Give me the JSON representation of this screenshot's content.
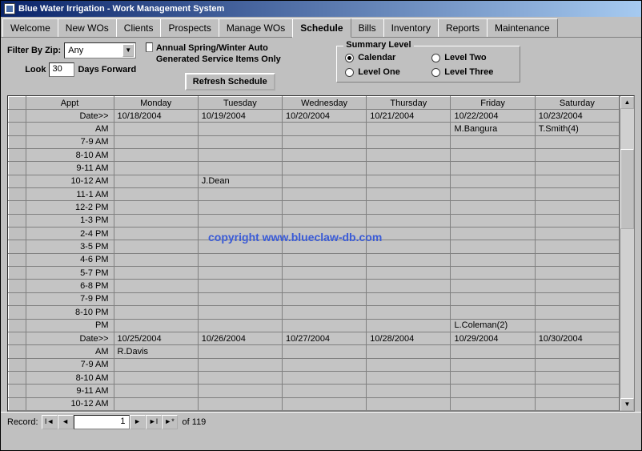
{
  "window": {
    "title": "Blue Water Irrigation - Work Management System"
  },
  "tabs": [
    "Welcome",
    "New WOs",
    "Clients",
    "Prospects",
    "Manage WOs",
    "Schedule",
    "Bills",
    "Inventory",
    "Reports",
    "Maintenance"
  ],
  "active_tab": "Schedule",
  "filter": {
    "zip_label": "Filter By Zip:",
    "zip_value": "Any",
    "look_label": "Look",
    "look_value": "30",
    "days_forward": "Days Forward"
  },
  "annual": {
    "label": "Annual Spring/Winter Auto Generated Service Items Only",
    "checked": false
  },
  "refresh_btn": "Refresh Schedule",
  "summary": {
    "legend": "Summary Level",
    "options": [
      "Calendar",
      "Level Two",
      "Level One",
      "Level Three"
    ],
    "selected": "Calendar"
  },
  "grid": {
    "headers": [
      "Appt",
      "Monday",
      "Tuesday",
      "Wednesday",
      "Thursday",
      "Friday",
      "Saturday"
    ],
    "rows": [
      {
        "appt": "Date>>",
        "cells": [
          "10/18/2004",
          "10/19/2004",
          "10/20/2004",
          "10/21/2004",
          "10/22/2004",
          "10/23/2004"
        ]
      },
      {
        "appt": "AM",
        "cells": [
          "",
          "",
          "",
          "",
          "M.Bangura",
          "T.Smith(4)"
        ]
      },
      {
        "appt": "7-9 AM",
        "cells": [
          "",
          "",
          "",
          "",
          "",
          ""
        ]
      },
      {
        "appt": "8-10 AM",
        "cells": [
          "",
          "",
          "",
          "",
          "",
          ""
        ]
      },
      {
        "appt": "9-11 AM",
        "cells": [
          "",
          "",
          "",
          "",
          "",
          ""
        ]
      },
      {
        "appt": "10-12 AM",
        "cells": [
          "",
          "J.Dean",
          "",
          "",
          "",
          ""
        ]
      },
      {
        "appt": "11-1 AM",
        "cells": [
          "",
          "",
          "",
          "",
          "",
          ""
        ]
      },
      {
        "appt": "12-2 PM",
        "cells": [
          "",
          "",
          "",
          "",
          "",
          ""
        ]
      },
      {
        "appt": "1-3 PM",
        "cells": [
          "",
          "",
          "",
          "",
          "",
          ""
        ]
      },
      {
        "appt": "2-4 PM",
        "cells": [
          "",
          "",
          "",
          "",
          "",
          ""
        ]
      },
      {
        "appt": "3-5 PM",
        "cells": [
          "",
          "",
          "",
          "",
          "",
          ""
        ]
      },
      {
        "appt": "4-6 PM",
        "cells": [
          "",
          "",
          "",
          "",
          "",
          ""
        ]
      },
      {
        "appt": "5-7 PM",
        "cells": [
          "",
          "",
          "",
          "",
          "",
          ""
        ]
      },
      {
        "appt": "6-8 PM",
        "cells": [
          "",
          "",
          "",
          "",
          "",
          ""
        ]
      },
      {
        "appt": "7-9 PM",
        "cells": [
          "",
          "",
          "",
          "",
          "",
          ""
        ]
      },
      {
        "appt": "8-10 PM",
        "cells": [
          "",
          "",
          "",
          "",
          "",
          ""
        ]
      },
      {
        "appt": "PM",
        "cells": [
          "",
          "",
          "",
          "",
          "L.Coleman(2)",
          ""
        ]
      },
      {
        "appt": "Date>>",
        "cells": [
          "10/25/2004",
          "10/26/2004",
          "10/27/2004",
          "10/28/2004",
          "10/29/2004",
          "10/30/2004"
        ]
      },
      {
        "appt": "AM",
        "cells": [
          "R.Davis",
          "",
          "",
          "",
          "",
          ""
        ]
      },
      {
        "appt": "7-9 AM",
        "cells": [
          "",
          "",
          "",
          "",
          "",
          ""
        ]
      },
      {
        "appt": "8-10 AM",
        "cells": [
          "",
          "",
          "",
          "",
          "",
          ""
        ]
      },
      {
        "appt": "9-11 AM",
        "cells": [
          "",
          "",
          "",
          "",
          "",
          ""
        ]
      },
      {
        "appt": "10-12 AM",
        "cells": [
          "",
          "",
          "",
          "",
          "",
          ""
        ]
      }
    ]
  },
  "recordnav": {
    "label": "Record:",
    "current": "1",
    "of": "of  119"
  },
  "watermark": "copyright www.blueclaw-db.com"
}
